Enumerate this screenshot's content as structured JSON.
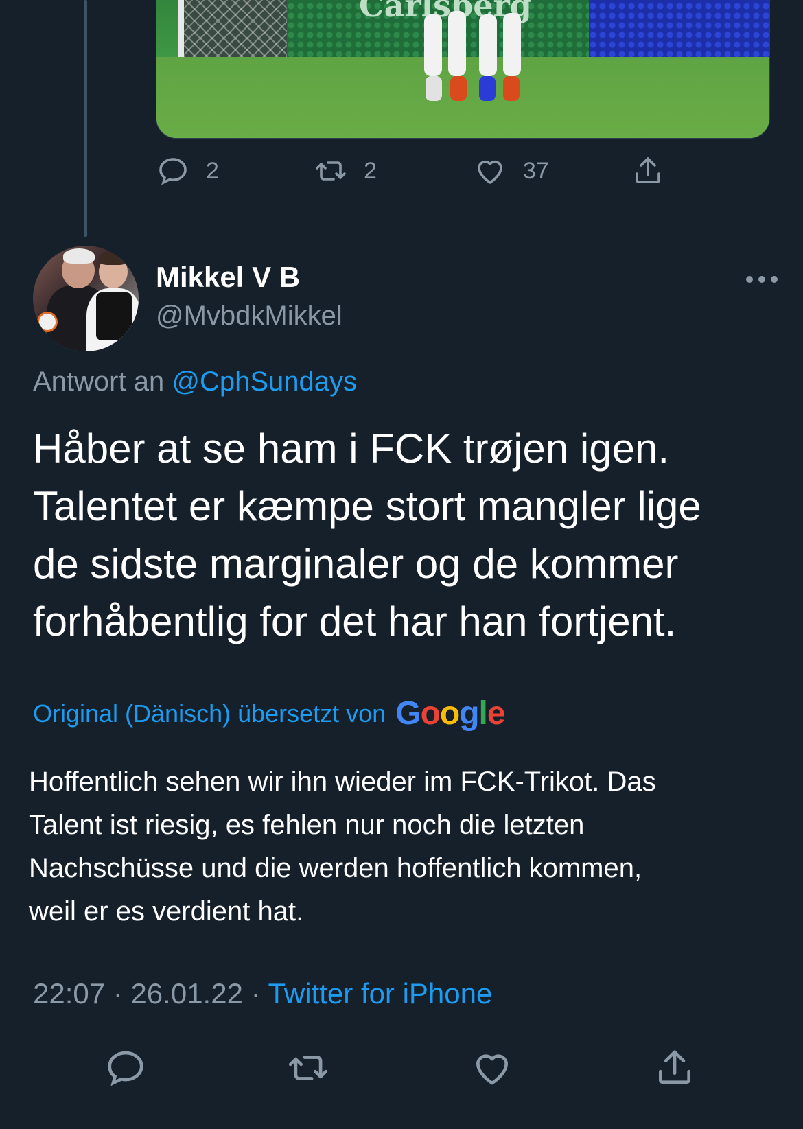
{
  "previous_tweet": {
    "media_caption": "Carlsberg",
    "actions": {
      "reply_count": "2",
      "retweet_count": "2",
      "like_count": "37"
    }
  },
  "tweet": {
    "author": {
      "name": "Mikkel V B",
      "handle": "@MvbdkMikkel"
    },
    "reply_to": {
      "prefix": "Antwort an",
      "mention": "@CphSundays"
    },
    "text_lines": [
      "Håber at se ham i FCK trøjen igen.",
      "Talentet er kæmpe stort mangler lige",
      "de sidste marginaler og de kommer",
      "forhåbentlig for det har han fortjent."
    ],
    "translation": {
      "label": "Original (Dänisch) übersetzt von",
      "provider": "Google",
      "provider_letters": [
        "G",
        "o",
        "o",
        "g",
        "l",
        "e"
      ],
      "text_lines": [
        "Hoffentlich sehen wir ihn wieder im FCK-Trikot. Das",
        "Talent ist riesig, es fehlen nur noch die letzten",
        "Nachschüsse und die werden hoffentlich kommen,",
        "weil er es verdient hat."
      ]
    },
    "meta": {
      "time": "22:07",
      "separator": "·",
      "date": "26.01.22",
      "source": "Twitter for iPhone"
    }
  },
  "colors": {
    "background": "#15202b",
    "accent": "#1d9bf0",
    "muted": "#8b98a5",
    "text": "#ffffff"
  },
  "icons": {
    "reply": "reply-icon",
    "retweet": "retweet-icon",
    "like": "heart-icon",
    "share": "share-icon",
    "more": "more-options-icon"
  }
}
